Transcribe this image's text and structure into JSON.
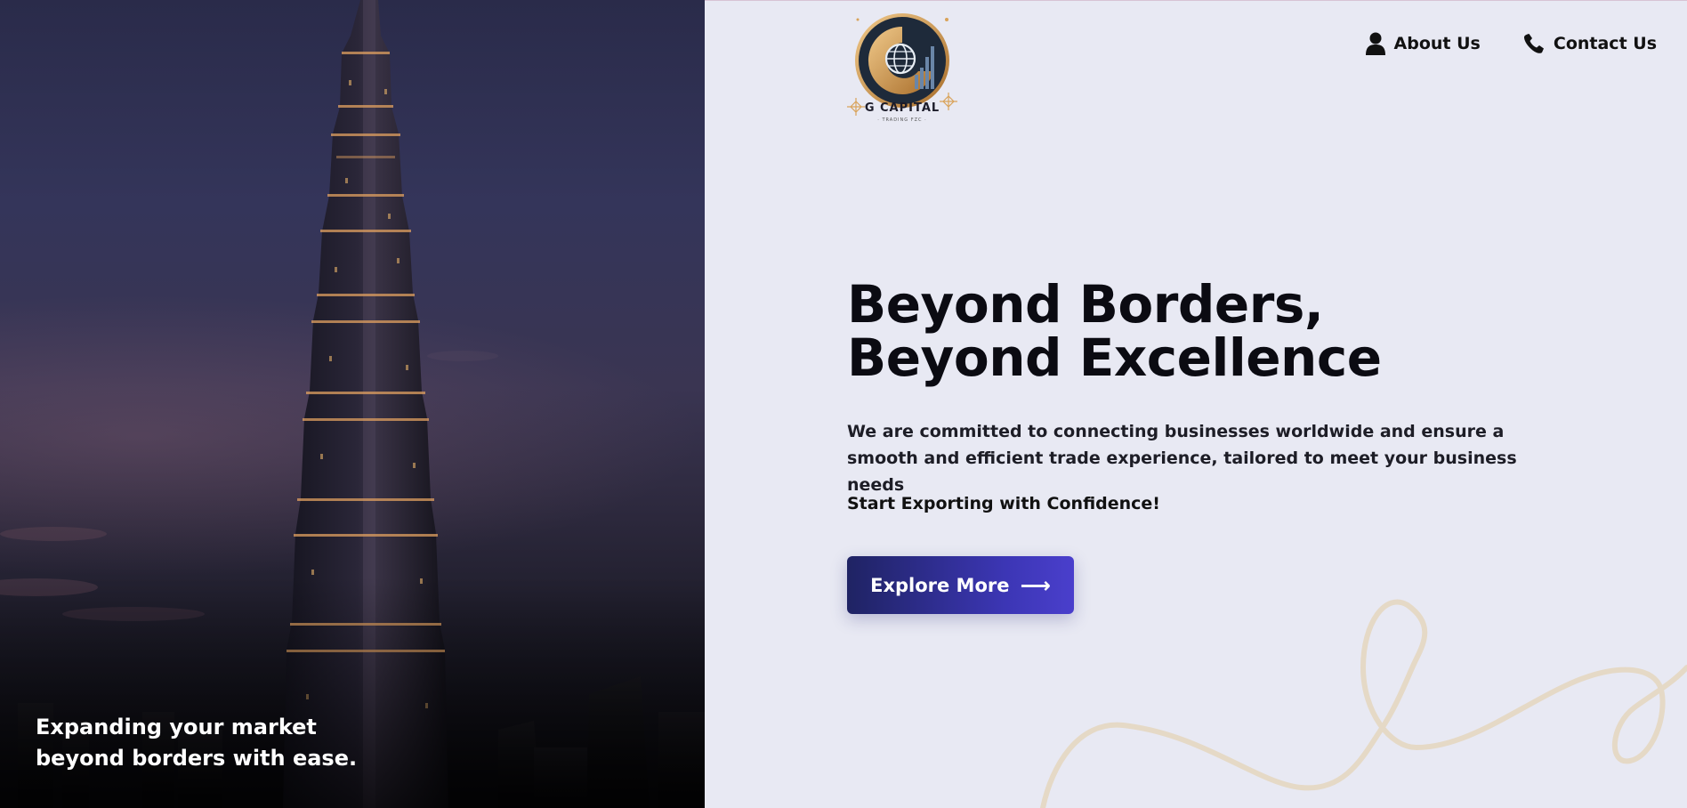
{
  "hero": {
    "caption": "Expanding your market beyond borders with ease."
  },
  "brand": {
    "name": "G CAPITAL",
    "sub": "· TRADING FZC ·",
    "logo_icon": "globe-chart-logo-icon"
  },
  "nav": {
    "items": [
      {
        "label": "About Us",
        "icon": "user-icon"
      },
      {
        "label": "Contact Us",
        "icon": "phone-icon"
      }
    ]
  },
  "main": {
    "headline": "Beyond Borders, Beyond Excellence",
    "description": "We are committed to connecting businesses worldwide and ensure a smooth and efficient trade experience, tailored to meet your business needs",
    "tagline": "Start Exporting with Confidence!",
    "cta_label": "Explore More",
    "cta_icon": "arrow-right-icon"
  },
  "colors": {
    "background": "#e8e9f3",
    "cta_start": "#1f2363",
    "cta_end": "#4a3fcc",
    "accent_gold": "#d9a35a",
    "squiggle": "#e5d9c6"
  }
}
